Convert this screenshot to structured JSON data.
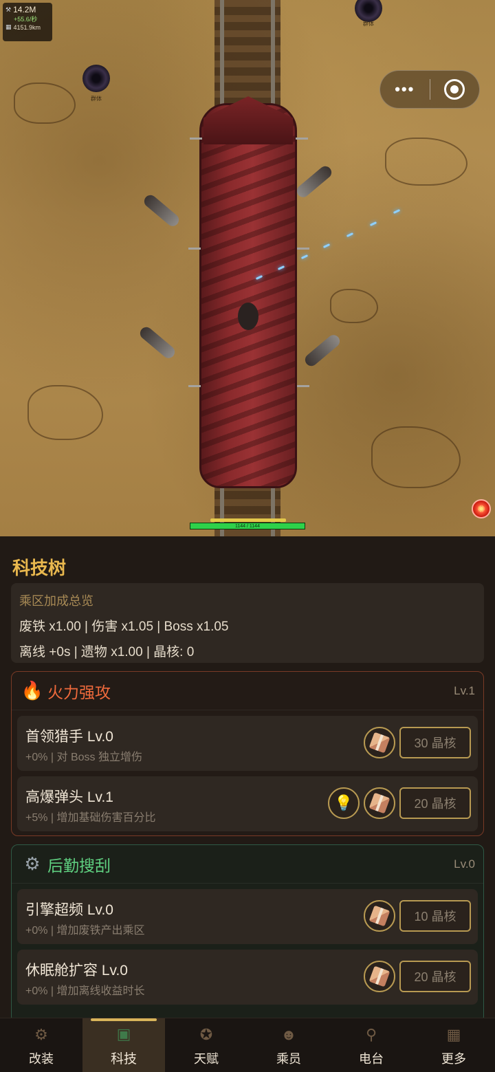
{
  "hud": {
    "scrap": "14.2M",
    "rate": "+55.6/秒",
    "distance": "4151.9km",
    "scrap_icon": "hammer-icon",
    "distance_icon": "map-icon"
  },
  "game": {
    "hp_text": "1144 / 1144",
    "hp_fraction": 1.0,
    "portal_labels": [
      "群体",
      "群体"
    ]
  },
  "capsule": {
    "more_icon": "•••",
    "close_icon": "target-icon"
  },
  "panel": {
    "title": "科技树",
    "summary": {
      "title": "乘区加成总览",
      "line1": "废铁 x1.00 | 伤害 x1.05 | Boss x1.05",
      "line2": "离线 +0s | 遗物 x1.00 | 晶核: 0"
    },
    "categories": [
      {
        "name": "火力强攻",
        "level": "Lv.1",
        "icon": "flame-icon",
        "items": [
          {
            "name": "首领猎手  Lv.0",
            "desc": "+0% | 对 Boss 独立增伤",
            "cost": "30 晶核"
          },
          {
            "name": "高爆弹头  Lv.1",
            "desc": "+5% | 增加基础伤害百分比",
            "cost": "20 晶核"
          }
        ]
      },
      {
        "name": "后勤搜刮",
        "level": "Lv.0",
        "icon": "gear-icon",
        "items": [
          {
            "name": "引擎超频  Lv.0",
            "desc": "+0% | 增加废铁产出乘区",
            "cost": "10 晶核"
          },
          {
            "name": "休眠舱扩容  Lv.0",
            "desc": "+0% | 增加离线收益时长",
            "cost": "20 晶核"
          }
        ]
      }
    ]
  },
  "tabs": [
    {
      "label": "改装",
      "icon": "wrench-icon"
    },
    {
      "label": "科技",
      "icon": "chip-icon",
      "active": true
    },
    {
      "label": "天赋",
      "icon": "star-badge-icon"
    },
    {
      "label": "乘员",
      "icon": "crew-icon"
    },
    {
      "label": "电台",
      "icon": "radio-icon"
    },
    {
      "label": "更多",
      "icon": "grid-icon"
    }
  ],
  "colors": {
    "accent": "#e9b84e",
    "fire": "#f06a3c",
    "logistics": "#5fcf80",
    "hp": "#2ed14a"
  }
}
